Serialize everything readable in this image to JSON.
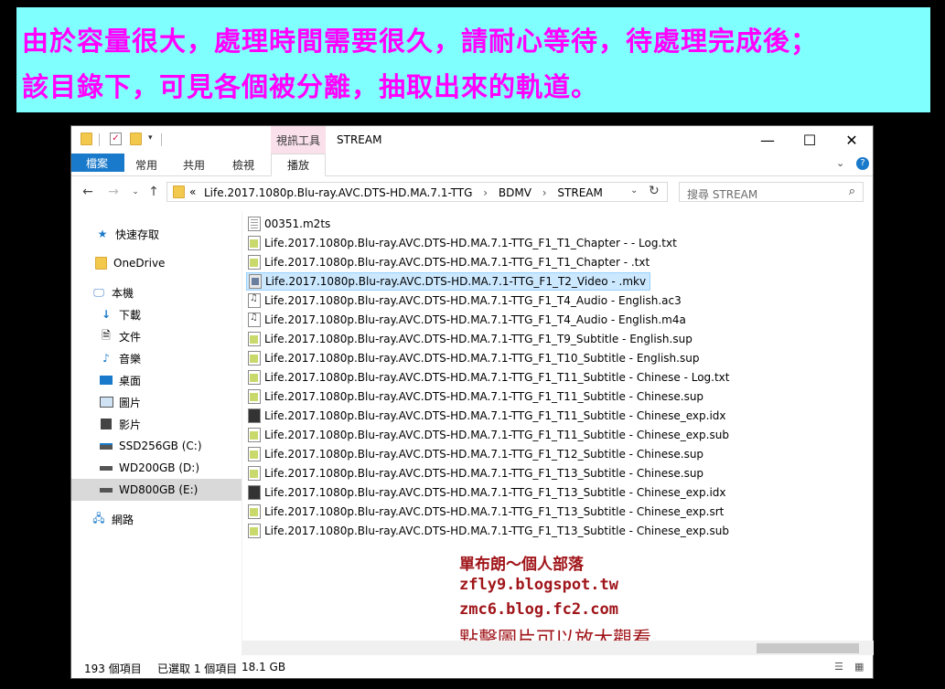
{
  "banner": {
    "line1": "由於容量很大，處理時間需要很久，請耐心等待，待處理完成後；",
    "line2": "該目錄下，可見各個被分離，抽取出來的軌道。",
    "bg": "#80ffff",
    "color": "#ff00ff"
  },
  "window": {
    "tool_tab": "視訊工具",
    "title": "STREAM",
    "ribbon_tabs": [
      "檔案",
      "常用",
      "共用",
      "檢視",
      "播放"
    ],
    "address": {
      "prefix": "«",
      "parts": [
        "Life.2017.1080p.Blu-ray.AVC.DTS-HD.MA.7.1-TTG",
        "BDMV",
        "STREAM"
      ]
    },
    "search_placeholder": "搜尋 STREAM"
  },
  "nav": [
    {
      "label": "快速存取",
      "icon": "star-icon"
    },
    {
      "label": "OneDrive",
      "icon": "folder-icon"
    },
    {
      "label": "本機",
      "icon": "computer-icon"
    },
    {
      "label": "下載",
      "icon": "download-icon"
    },
    {
      "label": "文件",
      "icon": "document-icon"
    },
    {
      "label": "音樂",
      "icon": "music-icon"
    },
    {
      "label": "桌面",
      "icon": "desktop-icon"
    },
    {
      "label": "圖片",
      "icon": "pictures-icon"
    },
    {
      "label": "影片",
      "icon": "video-icon"
    },
    {
      "label": "SSD256GB (C:)",
      "icon": "drive-icon"
    },
    {
      "label": "WD200GB (D:)",
      "icon": "drive-icon"
    },
    {
      "label": "WD800GB (E:)",
      "icon": "drive-icon"
    },
    {
      "label": "網路",
      "icon": "network-icon"
    }
  ],
  "files": [
    {
      "name": "00351.m2ts",
      "icon": "gen"
    },
    {
      "name": "Life.2017.1080p.Blu-ray.AVC.DTS-HD.MA.7.1-TTG_F1_T1_Chapter -  - Log.txt",
      "icon": "txt"
    },
    {
      "name": "Life.2017.1080p.Blu-ray.AVC.DTS-HD.MA.7.1-TTG_F1_T1_Chapter - .txt",
      "icon": "txt"
    },
    {
      "name": "Life.2017.1080p.Blu-ray.AVC.DTS-HD.MA.7.1-TTG_F1_T2_Video - .mkv",
      "icon": "mkv",
      "selected": true
    },
    {
      "name": "Life.2017.1080p.Blu-ray.AVC.DTS-HD.MA.7.1-TTG_F1_T4_Audio - English.ac3",
      "icon": "aud"
    },
    {
      "name": "Life.2017.1080p.Blu-ray.AVC.DTS-HD.MA.7.1-TTG_F1_T4_Audio - English.m4a",
      "icon": "aud"
    },
    {
      "name": "Life.2017.1080p.Blu-ray.AVC.DTS-HD.MA.7.1-TTG_F1_T9_Subtitle - English.sup",
      "icon": "txt"
    },
    {
      "name": "Life.2017.1080p.Blu-ray.AVC.DTS-HD.MA.7.1-TTG_F1_T10_Subtitle - English.sup",
      "icon": "txt"
    },
    {
      "name": "Life.2017.1080p.Blu-ray.AVC.DTS-HD.MA.7.1-TTG_F1_T11_Subtitle - Chinese - Log.txt",
      "icon": "txt"
    },
    {
      "name": "Life.2017.1080p.Blu-ray.AVC.DTS-HD.MA.7.1-TTG_F1_T11_Subtitle - Chinese.sup",
      "icon": "txt"
    },
    {
      "name": "Life.2017.1080p.Blu-ray.AVC.DTS-HD.MA.7.1-TTG_F1_T11_Subtitle - Chinese_exp.idx",
      "icon": "idx"
    },
    {
      "name": "Life.2017.1080p.Blu-ray.AVC.DTS-HD.MA.7.1-TTG_F1_T11_Subtitle - Chinese_exp.sub",
      "icon": "txt"
    },
    {
      "name": "Life.2017.1080p.Blu-ray.AVC.DTS-HD.MA.7.1-TTG_F1_T12_Subtitle - Chinese.sup",
      "icon": "txt"
    },
    {
      "name": "Life.2017.1080p.Blu-ray.AVC.DTS-HD.MA.7.1-TTG_F1_T13_Subtitle - Chinese.sup",
      "icon": "txt"
    },
    {
      "name": "Life.2017.1080p.Blu-ray.AVC.DTS-HD.MA.7.1-TTG_F1_T13_Subtitle - Chinese_exp.idx",
      "icon": "idx"
    },
    {
      "name": "Life.2017.1080p.Blu-ray.AVC.DTS-HD.MA.7.1-TTG_F1_T13_Subtitle - Chinese_exp.srt",
      "icon": "txt"
    },
    {
      "name": "Life.2017.1080p.Blu-ray.AVC.DTS-HD.MA.7.1-TTG_F1_T13_Subtitle - Chinese_exp.sub",
      "icon": "txt"
    }
  ],
  "watermark": {
    "line1": "單布朗～個人部落",
    "line2": "zfly9.blogspot.tw",
    "line3": "zmc6.blog.fc2.com",
    "line4": "點擊圖片可以放大觀看",
    "color": "#a0151a"
  },
  "status": {
    "count": "193 個項目",
    "selected": "已選取 1 個項目",
    "size": "18.1 GB"
  }
}
